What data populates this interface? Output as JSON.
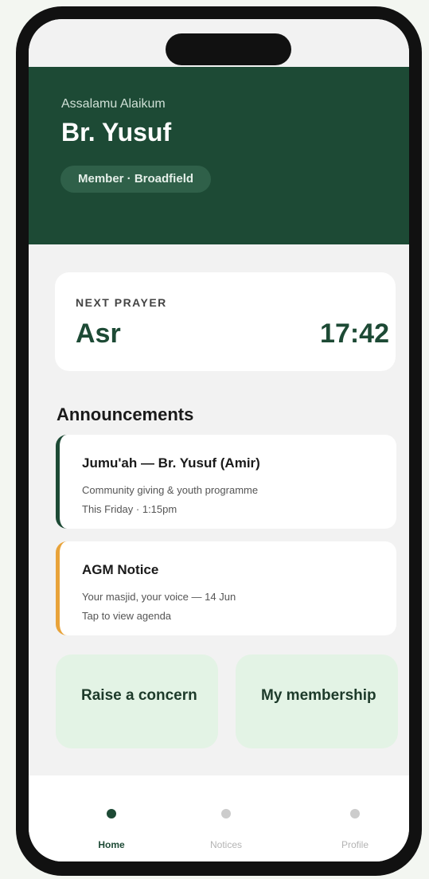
{
  "header": {
    "greeting": "Assalamu Alaikum",
    "name": "Br. Yusuf",
    "badge": "Member · Broadfield"
  },
  "next_prayer": {
    "label": "NEXT PRAYER",
    "name": "Asr",
    "time": "17:42"
  },
  "announcements": {
    "title": "Announcements",
    "items": [
      {
        "title": "Jumu'ah — Br. Yusuf (Amir)",
        "line1": "Community giving & youth programme",
        "line2": "This Friday · 1:15pm",
        "accent": "#1d4a35"
      },
      {
        "title": "AGM Notice",
        "line1": "Your masjid, your voice — 14 Jun",
        "line2": "Tap to view agenda",
        "accent": "#e8a33a"
      }
    ]
  },
  "actions": {
    "raise_concern": "Raise a concern",
    "my_membership": "My membership"
  },
  "tabs": [
    {
      "label": "Home",
      "icon": "home-dot-icon",
      "active": true
    },
    {
      "label": "Notices",
      "icon": "notices-dot-icon",
      "active": false
    },
    {
      "label": "Profile",
      "icon": "profile-dot-icon",
      "active": false
    }
  ],
  "colors": {
    "primary": "#1d4a35",
    "warning": "#e8a33a",
    "tile": "#e3f3e5"
  }
}
